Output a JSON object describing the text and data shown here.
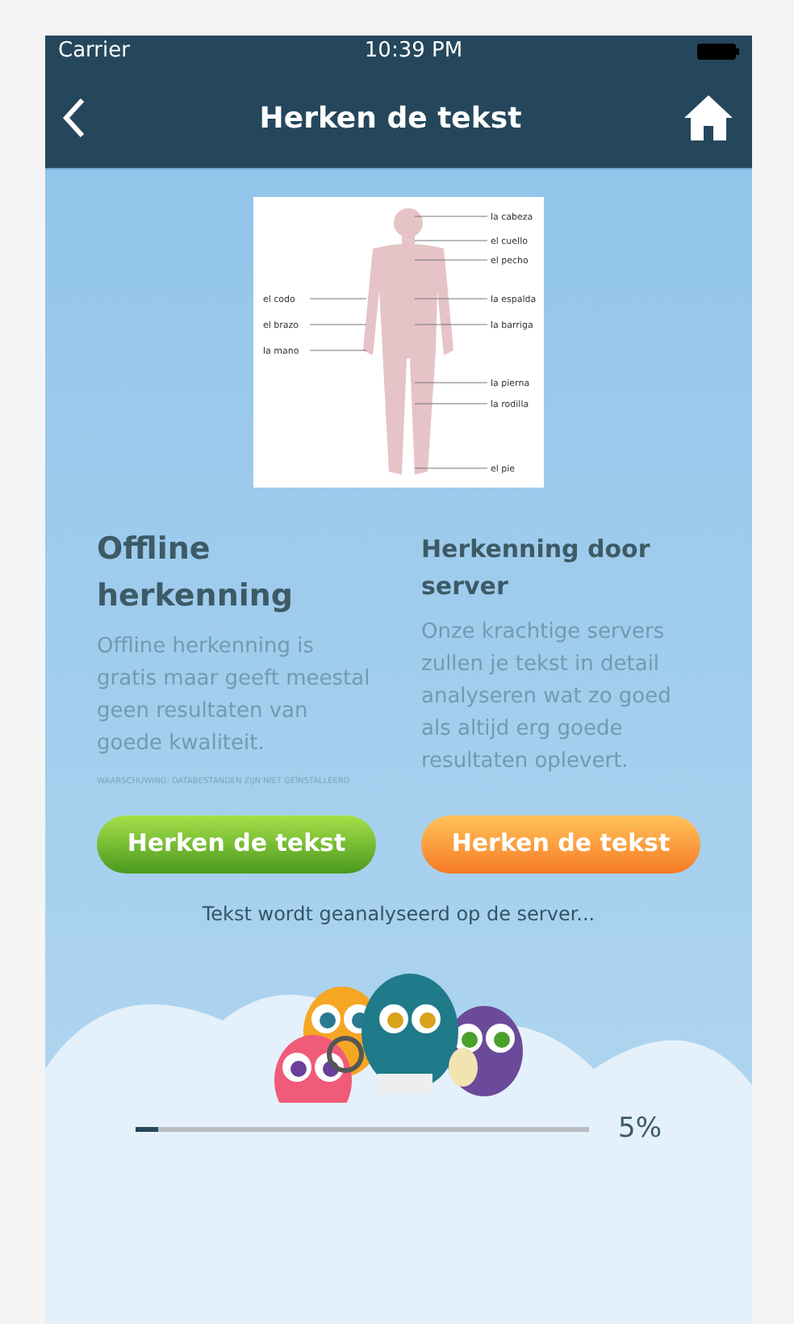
{
  "status_bar": {
    "carrier": "Carrier",
    "time": "10:39 PM"
  },
  "nav": {
    "title": "Herken de tekst"
  },
  "diagram": {
    "labels_right": [
      "la cabeza",
      "el cuello",
      "el pecho",
      "la espalda",
      "la barriga",
      "la pierna",
      "la rodilla",
      "el pie"
    ],
    "labels_left": [
      "el codo",
      "el brazo",
      "la mano"
    ]
  },
  "options": [
    {
      "kind": "offline",
      "title": "Offline herkenning",
      "text": "Offline herkenning is gratis maar geeft meestal geen resultaten van goede kwaliteit.",
      "warning": "WAARSCHUWING: DATABESTANDEN ZIJN NIET GEÏNSTALLEERD",
      "button": "Herken de tekst"
    },
    {
      "kind": "server",
      "title": "Herkenning door server",
      "text": "Onze krachtige servers zullen je tekst in detail analyseren wat zo goed als altijd erg goede resultaten oplevert.",
      "button": "Herken de tekst"
    }
  ],
  "status_text": "Tekst wordt geanalyseerd op de server...",
  "progress": {
    "level": 0.05,
    "reading": "5%"
  }
}
